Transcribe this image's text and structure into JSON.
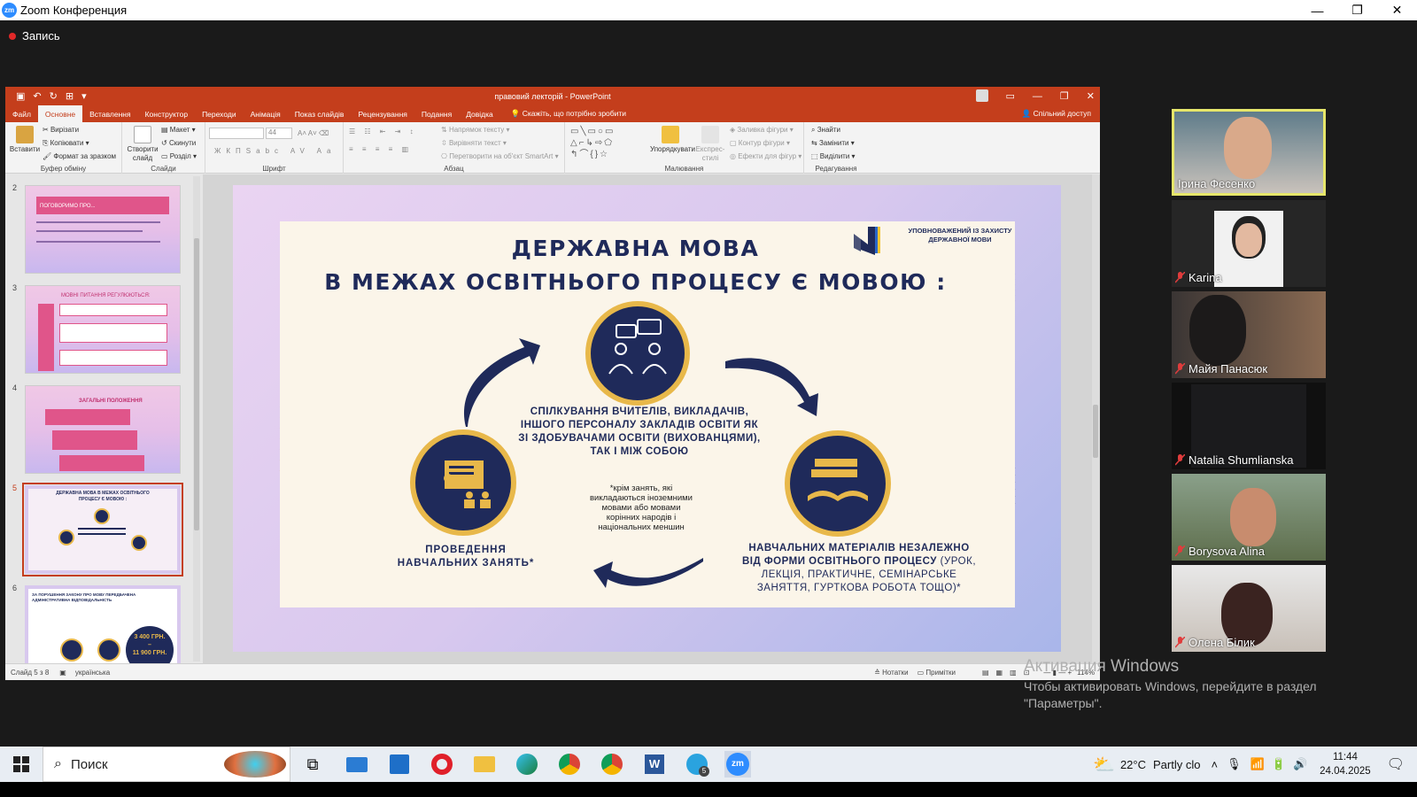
{
  "zoom": {
    "window_title": "Zoom Конференция",
    "logo_text": "zm",
    "recording_label": "Запись",
    "window_controls": [
      "—",
      "❐",
      "✕"
    ]
  },
  "powerpoint": {
    "doc_title": "правовий лекторій - PowerPoint",
    "tabs": [
      "Файл",
      "Основне",
      "Вставлення",
      "Конструктор",
      "Переходи",
      "Анімація",
      "Показ слайдів",
      "Рецензування",
      "Подання",
      "Довідка"
    ],
    "tell_me": "Скажіть, що потрібно зробити",
    "share": "Спільний доступ",
    "ribbon": {
      "paste": "Вставити",
      "cut": "Вирізати",
      "copy": "Копіювати",
      "format_painter": "Формат за зразком",
      "clipboard_group": "Буфер обміну",
      "new_slide": "Створити слайд",
      "layout": "Макет",
      "reset": "Скинути",
      "section": "Розділ",
      "slides_group": "Слайди",
      "font_size": "44",
      "font_group": "Шрифт",
      "text_direction": "Напрямок тексту",
      "align_text": "Вирівняти текст",
      "convert_smartart": "Перетворити на об'єкт SmartArt",
      "paragraph_group": "Абзац",
      "arrange": "Упорядкувати",
      "quick_styles": "Експрес-стилі",
      "shape_fill": "Заливка фігури",
      "shape_outline": "Контур фігури",
      "shape_effects": "Ефекти для фігур",
      "drawing_group": "Малювання",
      "find": "Знайти",
      "replace": "Замінити",
      "select": "Виділити",
      "editing_group": "Редагування"
    },
    "thumbnails": [
      {
        "num": "2",
        "title": "ПОГОВОРИМО ПРО..."
      },
      {
        "num": "3",
        "title": "МОВНІ ПИТАННЯ РЕГУЛЮЮТЬСЯ:"
      },
      {
        "num": "4",
        "title": "ЗАГАЛЬНІ ПОЛОЖЕННЯ"
      },
      {
        "num": "5",
        "title": "ДЕРЖАВНА МОВА В МЕЖАХ ОСВІТНЬОГО ПРОЦЕСУ Є МОВОЮ :"
      },
      {
        "num": "6",
        "title": "ЗА ПОРУШЕННЯ ЗАКОНУ ПРО МОВУ ПЕРЕДБАЧЕНА АДМІНІСТРАТИВНА ВІДПОВІДАЛЬНІСТЬ"
      }
    ],
    "thumb6": {
      "amount1": "3 400 ГРН.",
      "dash": "–",
      "amount2": "11 900 ГРН."
    },
    "slide": {
      "logo_text_line1": "УПОВНОВАЖЕНИЙ ІЗ ЗАХИСТУ",
      "logo_text_line2": "ДЕРЖАВНОЇ МОВИ",
      "title_line1": "ДЕРЖАВНА МОВА",
      "title_line2": "В МЕЖАХ ОСВІТНЬОГО ПРОЦЕСУ Є МОВОЮ :",
      "center_text": "СПІЛКУВАННЯ ВЧИТЕЛІВ, ВИКЛАДАЧІВ, ІНШОГО ПЕРСОНАЛУ ЗАКЛАДІВ ОСВІТИ ЯК ЗІ ЗДОБУВАЧАМИ ОСВІТИ (ВИХОВАНЦЯМИ), ТАК І МІЖ СОБОЮ",
      "left_text": "ПРОВЕДЕННЯ НАВЧАЛЬНИХ ЗАНЯТЬ*",
      "note_text": "*крім занять, які викладаються іноземними мовами або мовами корінних народів і національних меншин",
      "right_text_bold": "НАВЧАЛЬНИХ МАТЕРІАЛІВ НЕЗАЛЕЖНО ВІД ФОРМИ ОСВІТНЬОГО ПРОЦЕСУ",
      "right_text_normal": "(УРОК, ЛЕКЦІЯ, ПРАКТИЧНЕ, СЕМІНАРСЬКЕ ЗАНЯТТЯ, ГУРТКОВА РОБОТА ТОЩО)*"
    },
    "status": {
      "slide_counter": "Слайд 5 з 8",
      "language": "українська",
      "notes": "Нотатки",
      "comments": "Примітки",
      "zoom": "114%"
    }
  },
  "participants": [
    {
      "name": "Ірина Фесенко",
      "muted": false,
      "active": true
    },
    {
      "name": "Karina",
      "muted": true,
      "active": false
    },
    {
      "name": "Майя Панасюк",
      "muted": true,
      "active": false
    },
    {
      "name": "Natalia Shumlianska",
      "muted": true,
      "active": false
    },
    {
      "name": "Borysova Alina",
      "muted": true,
      "active": false
    },
    {
      "name": "Олена Білик",
      "muted": true,
      "active": false
    }
  ],
  "activation": {
    "title": "Активация Windows",
    "message": "Чтобы активировать Windows, перейдите в раздел \"Параметры\"."
  },
  "taskbar": {
    "search_placeholder": "Поиск",
    "temperature": "22°C",
    "weather": "Partly clo",
    "time": "11:44",
    "date": "24.04.2025",
    "telegram_badge": "5"
  },
  "colors": {
    "ppt_accent": "#c43e1c",
    "navy": "#1f2a5a",
    "gold": "#e8b84a",
    "zoom_blue": "#2d8cff",
    "active_speaker": "#e6e66a"
  }
}
